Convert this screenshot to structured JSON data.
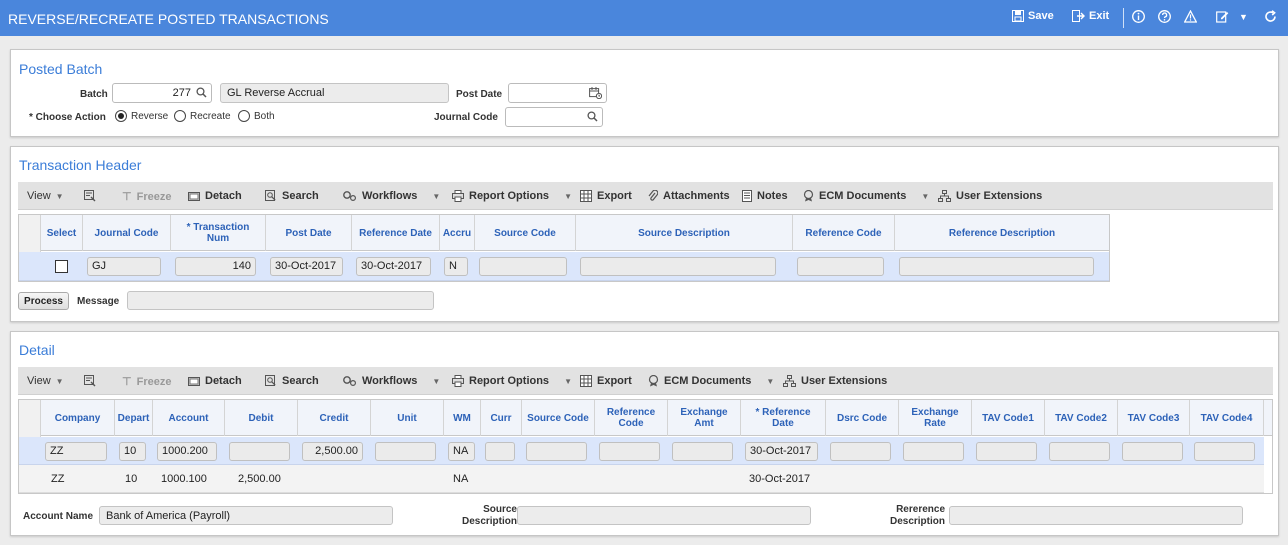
{
  "window": {
    "title": "REVERSE/RECREATE POSTED TRANSACTIONS",
    "save_label": "Save",
    "exit_label": "Exit"
  },
  "posted_batch": {
    "section_title": "Posted Batch",
    "batch_label": "Batch",
    "batch_value": "277",
    "batch_description": "GL Reverse Accrual",
    "post_date_label": "Post Date",
    "post_date_value": "",
    "choose_action_label": "* Choose Action",
    "actions": [
      "Reverse",
      "Recreate",
      "Both"
    ],
    "selected_action": "Reverse",
    "journal_code_label": "Journal Code",
    "journal_code_value": ""
  },
  "transaction_header": {
    "section_title": "Transaction Header",
    "toolbar": {
      "view": "View",
      "freeze": "Freeze",
      "detach": "Detach",
      "search": "Search",
      "workflows": "Workflows",
      "report_options": "Report Options",
      "export": "Export",
      "attachments": "Attachments",
      "notes": "Notes",
      "ecm_documents": "ECM Documents",
      "user_extensions": "User Extensions"
    },
    "columns": [
      "Select",
      "Journal Code",
      "* Transaction Num",
      "Post Date",
      "Reference Date",
      "Accru",
      "Source Code",
      "Source Description",
      "Reference Code",
      "Reference Description"
    ],
    "row": {
      "journal_code": "GJ",
      "transaction_num": "140",
      "post_date": "30-Oct-2017",
      "reference_date": "30-Oct-2017",
      "accrual": "N",
      "source_code": "",
      "source_description": "",
      "reference_code": "",
      "reference_description": ""
    },
    "process_label": "Process",
    "message_label": "Message",
    "message_value": ""
  },
  "detail": {
    "section_title": "Detail",
    "toolbar": {
      "view": "View",
      "freeze": "Freeze",
      "detach": "Detach",
      "search": "Search",
      "workflows": "Workflows",
      "report_options": "Report Options",
      "export": "Export",
      "ecm_documents": "ECM Documents",
      "user_extensions": "User Extensions"
    },
    "columns": [
      "Company",
      "Depart",
      "Account",
      "Debit",
      "Credit",
      "Unit",
      "WM",
      "Curr",
      "Source Code",
      "Reference Code",
      "Exchange Amt",
      "* Reference Date",
      "Dsrc Code",
      "Exchange Rate",
      "TAV Code1",
      "TAV Code2",
      "TAV Code3",
      "TAV Code4"
    ],
    "rows": [
      {
        "company": "ZZ",
        "depart": "10",
        "account": "1000.200",
        "debit": "",
        "credit": "2,500.00",
        "wm": "NA",
        "reference_date": "30-Oct-2017"
      },
      {
        "company": "ZZ",
        "depart": "10",
        "account": "1000.100",
        "debit": "2,500.00",
        "credit": "",
        "wm": "NA",
        "reference_date": "30-Oct-2017"
      }
    ],
    "account_name_label": "Account Name",
    "account_name_value": "Bank of America (Payroll)",
    "source_description_label_1": "Source",
    "source_description_label_2": "Description",
    "source_description_value": "",
    "reference_description_label_1": "Rererence",
    "reference_description_label_2": "Description",
    "reference_description_value": ""
  },
  "colors": {
    "title_bar": "#4a86dc",
    "section_title": "#3b7dd8",
    "grid_header_text": "#2d62b8",
    "selected_row": "#dbe6fb"
  }
}
